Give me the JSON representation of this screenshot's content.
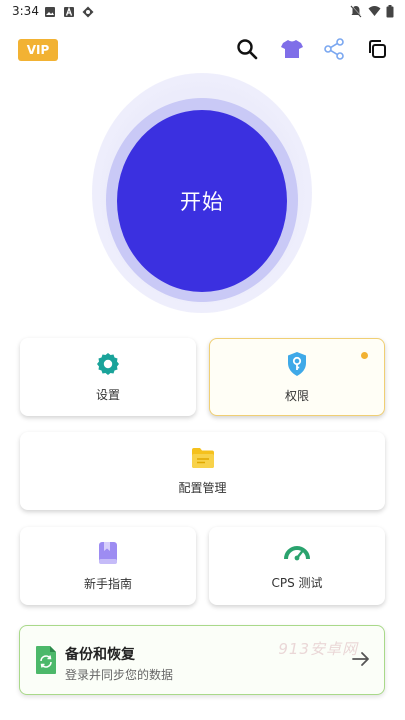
{
  "status_bar": {
    "time": "3:34"
  },
  "header": {
    "vip_label": "VIP",
    "icons": [
      "search-icon",
      "tshirt-icon",
      "share-icon",
      "copy-icon"
    ]
  },
  "main": {
    "start_label": "开始"
  },
  "cards": {
    "settings_label": "设置",
    "permissions_label": "权限",
    "config_label": "配置管理",
    "guide_label": "新手指南",
    "cps_label": "CPS 测试"
  },
  "backup": {
    "title": "备份和恢复",
    "subtitle": "登录并同步您的数据"
  },
  "watermark": "913安卓网",
  "colors": {
    "accent": "#3b30e0",
    "vip": "#f2b233",
    "settings_icon": "#1aa39a",
    "permission_icon": "#3fa9e8",
    "folder_icon": "#f5c11d",
    "guide_icon": "#9d8cf2",
    "gauge_icon": "#2aa36e",
    "backup_border": "#a9d98a"
  }
}
